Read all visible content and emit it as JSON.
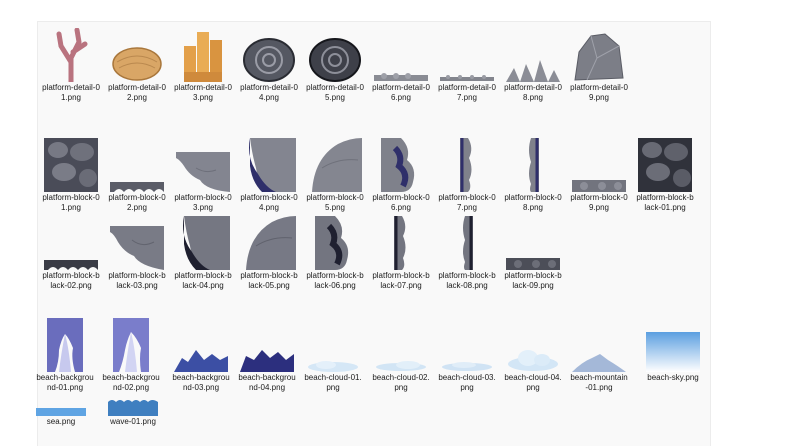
{
  "files": {
    "row1": [
      {
        "name": "platform-detail-0\n1.png",
        "icon": "coral-icon"
      },
      {
        "name": "platform-detail-0\n2.png",
        "icon": "sponge-rock-icon"
      },
      {
        "name": "platform-detail-0\n3.png",
        "icon": "orange-coral-icon"
      },
      {
        "name": "platform-detail-0\n4.png",
        "icon": "shell-icon"
      },
      {
        "name": "platform-detail-0\n5.png",
        "icon": "dark-shell-icon"
      },
      {
        "name": "platform-detail-0\n6.png",
        "icon": "pebble-strip-icon"
      },
      {
        "name": "platform-detail-0\n7.png",
        "icon": "pebble-line-icon"
      },
      {
        "name": "platform-detail-0\n8.png",
        "icon": "spikes-icon"
      },
      {
        "name": "platform-detail-0\n9.png",
        "icon": "boulder-icon"
      }
    ],
    "row2": [
      {
        "name": "platform-block-0\n1.png",
        "icon": "stone-block-icon"
      },
      {
        "name": "platform-block-0\n2.png",
        "icon": "scalloped-edge-icon"
      },
      {
        "name": "platform-block-0\n3.png",
        "icon": "corner-top-left-icon"
      },
      {
        "name": "platform-block-0\n4.png",
        "icon": "corner-bottom-left-icon"
      },
      {
        "name": "platform-block-0\n5.png",
        "icon": "curve-block-icon"
      },
      {
        "name": "platform-block-0\n6.png",
        "icon": "side-edge-icon"
      },
      {
        "name": "platform-block-0\n7.png",
        "icon": "thin-edge-icon"
      },
      {
        "name": "platform-block-0\n8.png",
        "icon": "thin-edge-right-icon"
      },
      {
        "name": "platform-block-0\n9.png",
        "icon": "flat-edge-icon"
      },
      {
        "name": "platform-block-b\nlack-01.png",
        "icon": "black-stone-block-icon"
      }
    ],
    "row3": [
      {
        "name": "platform-block-b\nlack-02.png",
        "icon": "black-scalloped-icon"
      },
      {
        "name": "platform-block-b\nlack-03.png",
        "icon": "black-corner-icon"
      },
      {
        "name": "platform-block-b\nlack-04.png",
        "icon": "black-corner-bottom-icon"
      },
      {
        "name": "platform-block-b\nlack-05.png",
        "icon": "black-curve-icon"
      },
      {
        "name": "platform-block-b\nlack-06.png",
        "icon": "black-side-icon"
      },
      {
        "name": "platform-block-b\nlack-07.png",
        "icon": "black-thin-edge-icon"
      },
      {
        "name": "platform-block-b\nlack-08.png",
        "icon": "black-thin-edge-right-icon"
      },
      {
        "name": "platform-block-b\nlack-09.png",
        "icon": "black-flat-edge-icon"
      }
    ],
    "row4": [
      {
        "name": "beach-backgrou\nnd-01.png",
        "icon": "blue-cliff-icon"
      },
      {
        "name": "beach-backgrou\nnd-02.png",
        "icon": "blue-cliff-2-icon"
      },
      {
        "name": "beach-backgrou\nnd-03.png",
        "icon": "blue-mountains-icon"
      },
      {
        "name": "beach-backgrou\nnd-04.png",
        "icon": "dark-mountains-icon"
      },
      {
        "name": "beach-cloud-01.\npng",
        "icon": "cloud-icon"
      },
      {
        "name": "beach-cloud-02.\npng",
        "icon": "cloud-2-icon"
      },
      {
        "name": "beach-cloud-03.\npng",
        "icon": "cloud-3-icon"
      },
      {
        "name": "beach-cloud-04.\npng",
        "icon": "cloud-4-icon"
      },
      {
        "name": "beach-mountain\n-01.png",
        "icon": "pale-mountain-icon"
      },
      {
        "name": "beach-sky.png",
        "icon": "sky-gradient-icon"
      }
    ],
    "row5": [
      {
        "name": "sea.png",
        "icon": "sea-strip-icon"
      },
      {
        "name": "wave-01.png",
        "icon": "wave-icon"
      }
    ]
  }
}
